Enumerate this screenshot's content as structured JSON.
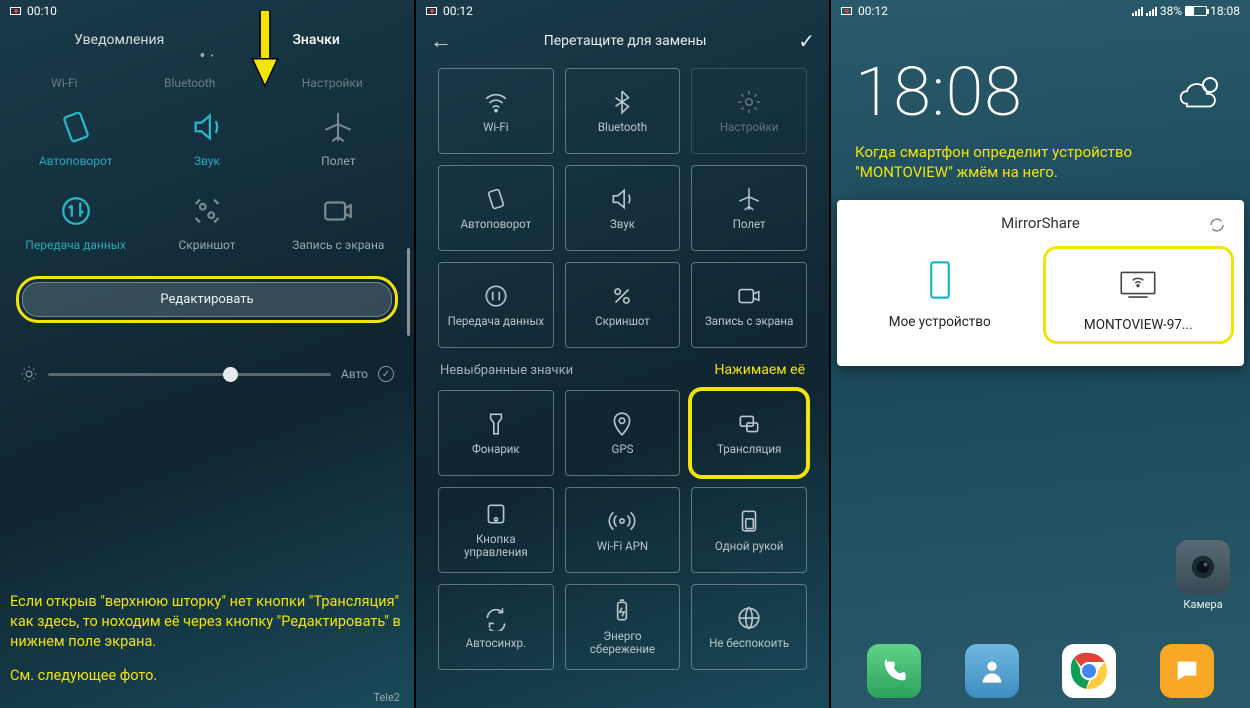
{
  "panel1": {
    "status_time": "00:10",
    "tabs": {
      "notifications": "Уведомления",
      "icons": "Значки"
    },
    "dim_row": [
      "Wi-Fi",
      "Bluetooth",
      "Настройки"
    ],
    "row2": [
      {
        "label": "Автоповорот"
      },
      {
        "label": "Звук"
      },
      {
        "label": "Полет"
      }
    ],
    "row3": [
      {
        "label": "Передача данных"
      },
      {
        "label": "Скриншот"
      },
      {
        "label": "Запись с экрана"
      }
    ],
    "edit_btn": "Редактировать",
    "brightness_auto": "Авто",
    "annotation": "Если открыв \"верхнюю шторку\" нет кнопки \"Трансляция\" как здесь, то ноходим её через кнопку \"Редактировать\" в нижнем поле экрана.",
    "annotation2": "См. следующее фото.",
    "carrier": "Tele2"
  },
  "panel2": {
    "status_time": "00:12",
    "header": "Перетащите для замены",
    "row1": [
      "Wi-Fi",
      "Bluetooth",
      "Настройки"
    ],
    "row2": [
      "Автоповорот",
      "Звук",
      "Полет"
    ],
    "row3": [
      "Передача данных",
      "Скриншот",
      "Запись с экрана"
    ],
    "section": "Невыбранные значки",
    "hint": "Нажимаем её",
    "row4": [
      "Фонарик",
      "GPS",
      "Трансляция"
    ],
    "row5": [
      "Кнопка управления",
      "Wi-Fi APN",
      "Одной рукой"
    ],
    "row6": [
      "Автосинхр.",
      "Энерго сбережение",
      "Не беспокоить"
    ]
  },
  "panel3": {
    "status_time": "00:12",
    "battery": "38%",
    "clock_time": "18:08",
    "clock_time2": "18:08",
    "annotation": "Когда смартфон определит устройство \"MONTOVIEW\" жмём на него.",
    "mirrorshare_title": "MirrorShare",
    "my_device": "Мое устройство",
    "montoview": "MONTOVIEW-97...",
    "camera_label": "Камера"
  }
}
